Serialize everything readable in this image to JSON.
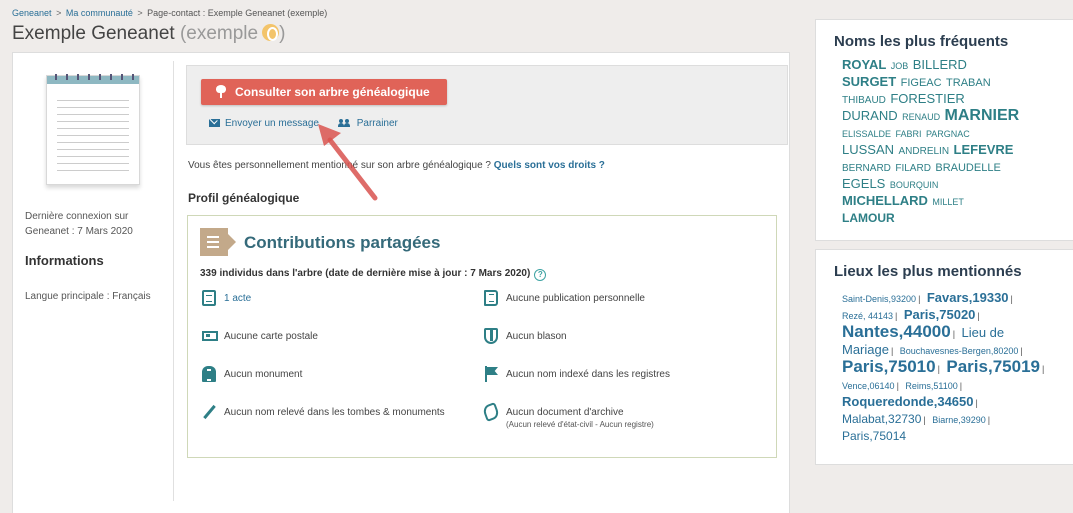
{
  "breadcrumb": {
    "items": [
      "Geneanet",
      "Ma communauté",
      "Page-contact : Exemple Geneanet (exemple)"
    ],
    "separator": ">"
  },
  "header": {
    "title": "Exemple Geneanet",
    "subtitle_open": "(exemple",
    "subtitle_close": ")"
  },
  "profile": {
    "last_login": "Dernière connexion sur Geneanet : 7 Mars 2020",
    "info_title": "Informations",
    "language": "Langue principale : Français"
  },
  "actions": {
    "tree_button": "Consulter son arbre généalogique",
    "message_link": "Envoyer un message",
    "sponsor_link": "Parrainer"
  },
  "mention": {
    "text": "Vous êtes personnellement mentionné sur son arbre généalogique ?",
    "rights_link": "Quels sont vos droits ?"
  },
  "profile_section": {
    "title": "Profil généalogique"
  },
  "contributions": {
    "title": "Contributions partagées",
    "count": "339 individus dans l'arbre (date de dernière mise à jour : 7 Mars 2020)",
    "help": "?",
    "items": [
      {
        "label": "1 acte",
        "icon": "document-icon"
      },
      {
        "label": "Aucune publication personnelle",
        "icon": "book-icon"
      },
      {
        "label": "Aucune carte postale",
        "icon": "postcard-icon"
      },
      {
        "label": "Aucun blason",
        "icon": "shield-icon"
      },
      {
        "label": "Aucun monument",
        "icon": "monument-icon"
      },
      {
        "label": "Aucun nom indexé dans les registres",
        "icon": "flag-icon"
      },
      {
        "label": "Aucun nom relevé dans les tombes & monuments",
        "icon": "pen-icon"
      },
      {
        "label": "Aucun document d'archive",
        "sub": "(Aucun relevé d'état-civil - Aucun registre)",
        "icon": "archive-icon"
      }
    ]
  },
  "names": {
    "title": "Noms les plus fréquents",
    "items": [
      {
        "label": "ROYAL"
      },
      {
        "label": "JOB"
      },
      {
        "label": "BILLERD"
      },
      {
        "label": "SURGET"
      },
      {
        "label": "FIGEAC"
      },
      {
        "label": "TRABAN"
      },
      {
        "label": "THIBAUD"
      },
      {
        "label": "FORESTIER"
      },
      {
        "label": "DURAND"
      },
      {
        "label": "RENAUD"
      },
      {
        "label": "MARNIER"
      },
      {
        "label": "ELISSALDE"
      },
      {
        "label": "FABRI"
      },
      {
        "label": "PARGNAC"
      },
      {
        "label": "LUSSAN"
      },
      {
        "label": "ANDRELIN"
      },
      {
        "label": "LEFEVRE"
      },
      {
        "label": "BERNARD"
      },
      {
        "label": "FILARD"
      },
      {
        "label": "BRAUDELLE"
      },
      {
        "label": "EGELS"
      },
      {
        "label": "BOURQUIN"
      },
      {
        "label": "MICHELLARD"
      },
      {
        "label": "MILLET"
      },
      {
        "label": "LAMOUR"
      }
    ]
  },
  "places": {
    "title": "Lieux les plus mentionnés",
    "items": [
      {
        "label": "Saint-Denis,93200"
      },
      {
        "label": "Favars,19330"
      },
      {
        "label": "Rezé, 44143"
      },
      {
        "label": "Paris,75020"
      },
      {
        "label": "Nantes,44000"
      },
      {
        "label": "Lieu de Mariage"
      },
      {
        "label": "Bouchavesnes-Bergen,80200"
      },
      {
        "label": "Paris,75010"
      },
      {
        "label": "Paris,75019"
      },
      {
        "label": "Vence,06140"
      },
      {
        "label": "Reims,51100"
      },
      {
        "label": "Roqueredonde,34650"
      },
      {
        "label": "Malabat,32730"
      },
      {
        "label": "Biarne,39290"
      },
      {
        "label": "Paris,75014"
      }
    ],
    "separator": "|"
  }
}
